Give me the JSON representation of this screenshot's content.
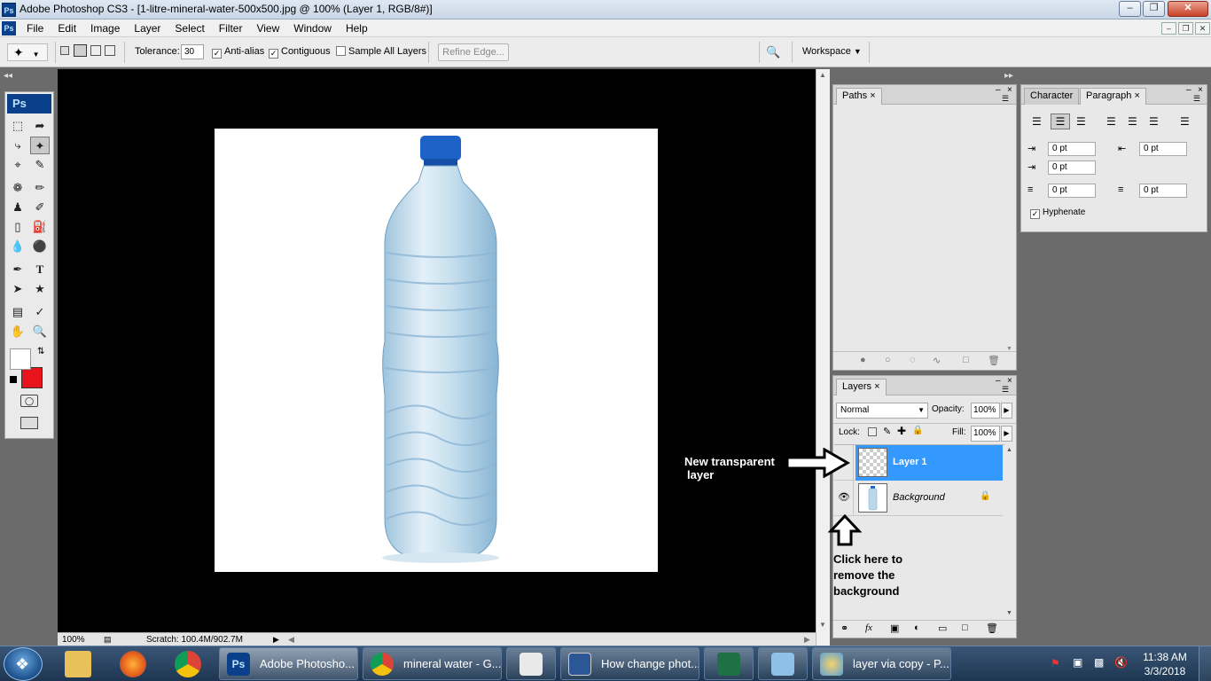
{
  "window": {
    "title": "Adobe Photoshop CS3 - [1-litre-mineral-water-500x500.jpg @ 100% (Layer 1, RGB/8#)]",
    "app_logo": "Ps"
  },
  "menu": {
    "items": [
      "File",
      "Edit",
      "Image",
      "Layer",
      "Select",
      "Filter",
      "View",
      "Window",
      "Help"
    ]
  },
  "options": {
    "tolerance_label": "Tolerance:",
    "tolerance_value": "30",
    "antialias_label": "Anti-alias",
    "contiguous_label": "Contiguous",
    "sample_all_label": "Sample All Layers",
    "refine_edge_label": "Refine Edge...",
    "workspace_label": "Workspace"
  },
  "toolbox": {
    "logo": "Ps"
  },
  "status": {
    "zoom": "100%",
    "scratch": "Scratch: 100.4M/902.7M"
  },
  "paths_panel": {
    "tab_label": "Paths"
  },
  "paragraph_panel": {
    "tab_character": "Character",
    "tab_paragraph": "Paragraph",
    "indent_left": "0 pt",
    "indent_right": "0 pt",
    "indent_first": "0 pt",
    "space_before": "0 pt",
    "space_after": "0 pt",
    "hyphenate_label": "Hyphenate"
  },
  "layers_panel": {
    "tab_label": "Layers",
    "blend_mode": "Normal",
    "opacity_label": "Opacity:",
    "opacity_value": "100%",
    "lock_label": "Lock:",
    "fill_label": "Fill:",
    "fill_value": "100%",
    "layers": [
      {
        "name": "Layer 1",
        "selected": true
      },
      {
        "name": "Background",
        "selected": false
      }
    ]
  },
  "annotations": {
    "new_layer_line1": "New transparent",
    "new_layer_line2": "layer",
    "click_line1": "Click here to",
    "click_line2": "remove the",
    "click_line3": "background"
  },
  "taskbar": {
    "tasks": [
      {
        "label": "Adobe Photosho...",
        "icon": "photoshop-icon"
      },
      {
        "label": "mineral water - G...",
        "icon": "chrome-icon"
      },
      {
        "label": "",
        "icon": "paint-brush-icon"
      },
      {
        "label": "How change phot...",
        "icon": "word-icon"
      },
      {
        "label": "",
        "icon": "excel-icon"
      },
      {
        "label": "",
        "icon": "notes-icon"
      },
      {
        "label": "layer via copy - P...",
        "icon": "paint-icon"
      }
    ],
    "time": "11:38 AM",
    "date": "3/3/2018"
  },
  "colors": {
    "selected_layer": "#3399ff",
    "foreground": "#ffffff",
    "background": "#e8141c"
  }
}
